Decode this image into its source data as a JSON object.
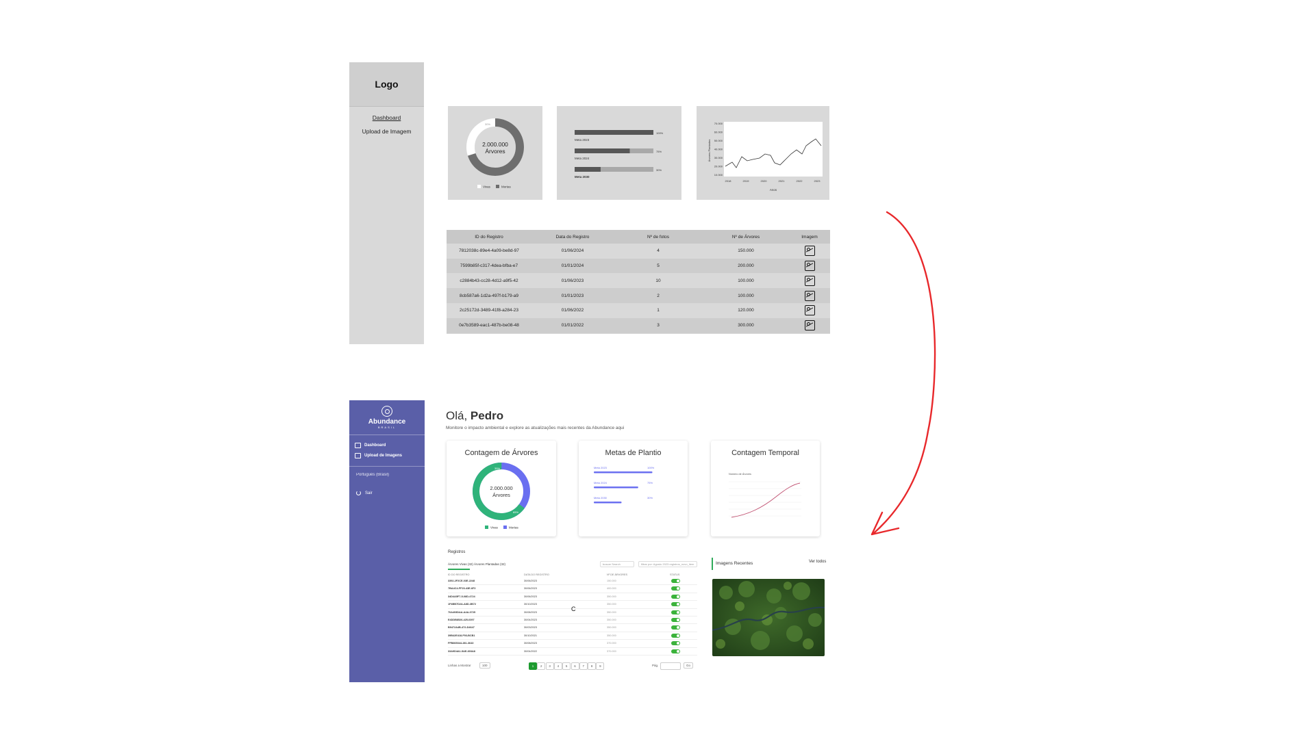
{
  "wireframe": {
    "logo": "Logo",
    "nav": [
      "Dashboard",
      "Upload de Imagem"
    ],
    "donut": {
      "center_value": "2.000.000",
      "center_label": "Árvores",
      "small_label": "30%",
      "legend": [
        "Vivas",
        "Mortas"
      ],
      "live_fraction": 0.3
    },
    "goals": [
      {
        "label": "Meta 2023",
        "percent": "100%",
        "fraction": 1.0,
        "bold": false
      },
      {
        "label": "Meta 2024",
        "percent": "75%",
        "fraction": 0.7,
        "bold": false
      },
      {
        "label": "Meta 2030",
        "percent": "30%",
        "fraction": 0.33,
        "bold": true
      }
    ],
    "temporal": {
      "y_ticks": [
        "70.000",
        "60.000",
        "50.000",
        "40.000",
        "30.000",
        "20.000",
        "10.000"
      ],
      "x_ticks": [
        "2018",
        "2019",
        "2020",
        "2021",
        "2022",
        "2023"
      ],
      "ylabel": "Árvores Plantadas",
      "xlabel": "Anos"
    },
    "table": {
      "headers": [
        "ID do Registro",
        "Data do Registro",
        "Nº de fotos",
        "Nº de Árvores",
        "Imagem"
      ],
      "rows": [
        [
          "7812038c-89e4-4a09-be8d-97",
          "01/06/2024",
          "4",
          "150.000"
        ],
        [
          "7599b85f-c317-4dea-bfba-e7",
          "01/01/2024",
          "5",
          "200.000"
        ],
        [
          "c2884b43-cc28-4d12-a9f5-42",
          "01/06/2023",
          "10",
          "100.000"
        ],
        [
          "8cb587a6-1d2a-497f-b179-a9",
          "01/01/2023",
          "2",
          "100.000"
        ],
        [
          "2c25172d-3489-41f8-a284-23",
          "01/06/2022",
          "1",
          "120.000"
        ],
        [
          "0e7b3589-eac1-487b-be08-48",
          "01/01/2022",
          "3",
          "300.000"
        ]
      ]
    }
  },
  "final": {
    "brand": "Abundance",
    "brand_sub": "BRASIL",
    "nav": [
      "Dashboard",
      "Upload de Imagens"
    ],
    "language": "Português (Brasil)",
    "logout": "Sair",
    "greeting_prefix": "Olá,",
    "greeting_name": "Pedro",
    "subtitle": "Monitore o impacto ambiental e explore as atualizações mais recentes da Abundance aqui",
    "cards": {
      "count_title": "Contagem de Árvores",
      "count_value": "2.000.000",
      "count_label": "Árvores",
      "count_small_a": "35%",
      "count_small_b": "65%",
      "count_legend": [
        "Vivas",
        "Mortas"
      ],
      "live_fraction": 0.35,
      "goals_title": "Metas de Plantio",
      "goals": [
        {
          "label": "Meta 2023",
          "percent": "100%",
          "fraction": 0.95
        },
        {
          "label": "Meta 2024",
          "percent": "75%",
          "fraction": 0.72
        },
        {
          "label": "Meta 2030",
          "percent": "30%",
          "fraction": 0.45
        }
      ],
      "temporal_title": "Contagem Temporal",
      "temporal_ylabel": "Número de Árvores"
    },
    "registros": {
      "title": "Registros",
      "tabs": [
        "Árvores Vivas (32)",
        "Árvores Plantadas (32)"
      ],
      "search_placeholder": "buscar  Search",
      "filter_label": "filtrar por:  Agosto 2023  registros_novo_item",
      "headers": [
        "ID DO REGISTRO",
        "DATA DO REGISTRO",
        "Nº DE ÁRVORES",
        "STATUS"
      ],
      "rows": [
        [
          "3392-2F2CE-03E-2248",
          "30/06/2023",
          "150.000"
        ],
        [
          "7BA4C4-FF20-43E-6F2",
          "30/06/2023",
          "400.000"
        ],
        [
          "34D4A5F7-5-08D-4724",
          "30/06/2023",
          "350.000"
        ],
        [
          "1F4BB7D2A-A8D-3B72",
          "30/10/2023",
          "350.000"
        ],
        [
          "70A493DAA-A4A-0725",
          "30/08/2023",
          "350.000"
        ],
        [
          "E4DDB8526-425-0397",
          "30/04/2023",
          "350.000"
        ],
        [
          "B9472A4B-472-D4647",
          "30/03/2023",
          "350.000"
        ],
        [
          "39B42E418-F93-BCB1",
          "30/10/2021",
          "350.000"
        ],
        [
          "FFB865344-281-3643",
          "30/08/2023",
          "370.000"
        ],
        [
          "33A9D4A1-5AE-603A8",
          "30/04/2022",
          "370.000"
        ]
      ],
      "rows_label": "Linhas a Mostrar",
      "rows_value": "100",
      "pages": [
        "1",
        "2",
        "3",
        "4",
        "5",
        "6",
        "7",
        "8",
        "9"
      ],
      "page_label": "Pág.",
      "go_label": "Go"
    },
    "recent_images_title": "Imagens Recentes",
    "see_all": "Ver todos",
    "cursor_text": "C"
  }
}
